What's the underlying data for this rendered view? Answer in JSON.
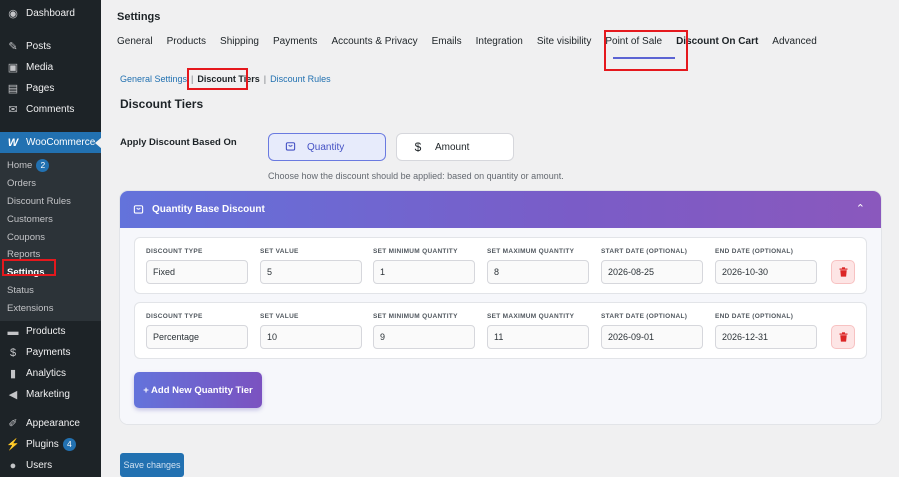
{
  "sidebar": {
    "items": [
      {
        "label": "Dashboard",
        "icon": "dashboard-icon",
        "glyph": "◉"
      },
      {
        "label": "Posts",
        "icon": "pin-icon",
        "glyph": "✎"
      },
      {
        "label": "Media",
        "icon": "media-icon",
        "glyph": "▣"
      },
      {
        "label": "Pages",
        "icon": "pages-icon",
        "glyph": "▤"
      },
      {
        "label": "Comments",
        "icon": "comments-icon",
        "glyph": "✉"
      }
    ],
    "woocommerce": {
      "label": "WooCommerce",
      "glyph": "W"
    },
    "sub": [
      {
        "label": "Home",
        "badge": "2"
      },
      {
        "label": "Orders"
      },
      {
        "label": "Discount Rules"
      },
      {
        "label": "Customers"
      },
      {
        "label": "Coupons"
      },
      {
        "label": "Reports"
      },
      {
        "label": "Settings"
      },
      {
        "label": "Status"
      },
      {
        "label": "Extensions"
      }
    ],
    "items2": [
      {
        "label": "Products",
        "icon": "products-icon",
        "glyph": "▬"
      },
      {
        "label": "Payments",
        "icon": "payments-icon",
        "glyph": "$"
      },
      {
        "label": "Analytics",
        "icon": "analytics-icon",
        "glyph": "▮"
      },
      {
        "label": "Marketing",
        "icon": "megaphone-icon",
        "glyph": "◀"
      }
    ],
    "items3": [
      {
        "label": "Appearance",
        "icon": "brush-icon",
        "glyph": "✐"
      },
      {
        "label": "Plugins",
        "icon": "plugin-icon",
        "glyph": "⚡",
        "badge": "4"
      },
      {
        "label": "Users",
        "icon": "users-icon",
        "glyph": "●"
      }
    ]
  },
  "page": {
    "title": "Settings",
    "tabs": [
      "General",
      "Products",
      "Shipping",
      "Payments",
      "Accounts & Privacy",
      "Emails",
      "Integration",
      "Site visibility",
      "Point of Sale",
      "Discount On Cart",
      "Advanced"
    ],
    "subnav": {
      "general": "General Settings",
      "tiers": "Discount Tiers",
      "rules": "Discount Rules"
    },
    "section_title": "Discount Tiers",
    "apply_label": "Apply Discount Based On",
    "options": {
      "quantity": "Quantity",
      "amount": "Amount"
    },
    "help": "Choose how the discount should be applied: based on quantity or amount.",
    "panel_title": "Quantity Base Discount",
    "field_labels": [
      "DISCOUNT TYPE",
      "SET VALUE",
      "SET MINIMUM QUANTITY",
      "SET MAXIMUM QUANTITY",
      "START DATE (OPTIONAL)",
      "END DATE (OPTIONAL)"
    ],
    "tiers": [
      {
        "type": "Fixed",
        "value": "5",
        "min": "1",
        "max": "8",
        "start": "2026-08-25",
        "end": "2026-10-30"
      },
      {
        "type": "Percentage",
        "value": "10",
        "min": "9",
        "max": "11",
        "start": "2026-09-01",
        "end": "2026-12-31"
      }
    ],
    "add_tier": "+ Add New Quantity Tier",
    "save": "Save changes"
  },
  "colors": {
    "accent": "#2271b1",
    "gradient_start": "#6373db",
    "gradient_end": "#8a58bd",
    "highlight": "#e5181d"
  }
}
